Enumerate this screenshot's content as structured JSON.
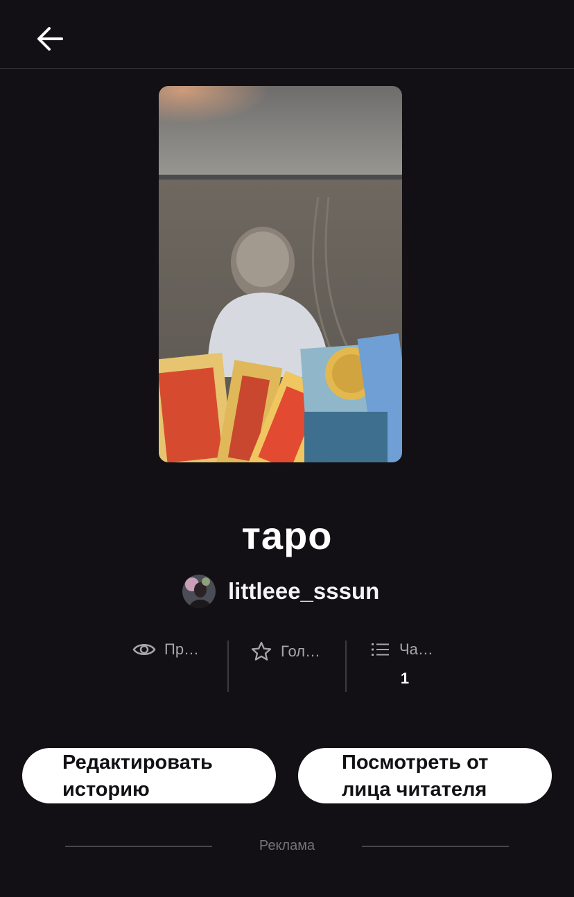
{
  "header": {
    "back_icon": "arrow-left-icon"
  },
  "story": {
    "title": "таро",
    "author": "littleee_sssun"
  },
  "stats": [
    {
      "icon": "eye-icon",
      "label": "Пр…",
      "value": ""
    },
    {
      "icon": "star-icon",
      "label": "Гол…",
      "value": ""
    },
    {
      "icon": "list-icon",
      "label": "Ча…",
      "value": "1"
    }
  ],
  "actions": {
    "edit_label": "Редактировать историю",
    "preview_label": "Посмотреть от лица читателя"
  },
  "ad": {
    "label": "Реклама"
  },
  "colors": {
    "background": "#121014",
    "button": "#ffffff",
    "muted_text": "#a9a6ab"
  }
}
